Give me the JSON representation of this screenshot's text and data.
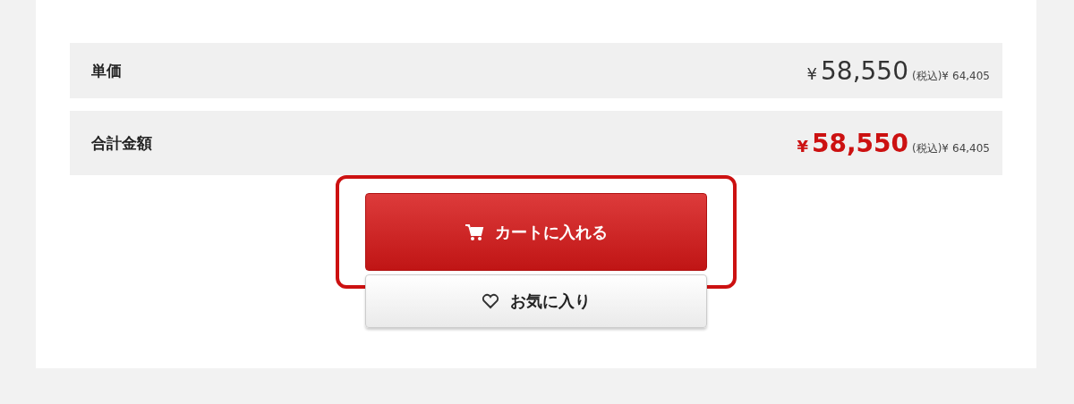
{
  "price_rows": [
    {
      "label": "単価",
      "emphasis": false,
      "yen": "¥",
      "amount": "58,550",
      "tax_label": "(税込)¥",
      "tax_amount": "64,405"
    },
    {
      "label": "合計金額",
      "emphasis": true,
      "yen": "¥",
      "amount": "58,550",
      "tax_label": "(税込)¥",
      "tax_amount": "64,405"
    }
  ],
  "buttons": [
    {
      "kind": "cart",
      "label": "カートに入れる",
      "highlighted": true
    },
    {
      "kind": "favorite",
      "label": "お気に入り",
      "highlighted": false
    }
  ]
}
